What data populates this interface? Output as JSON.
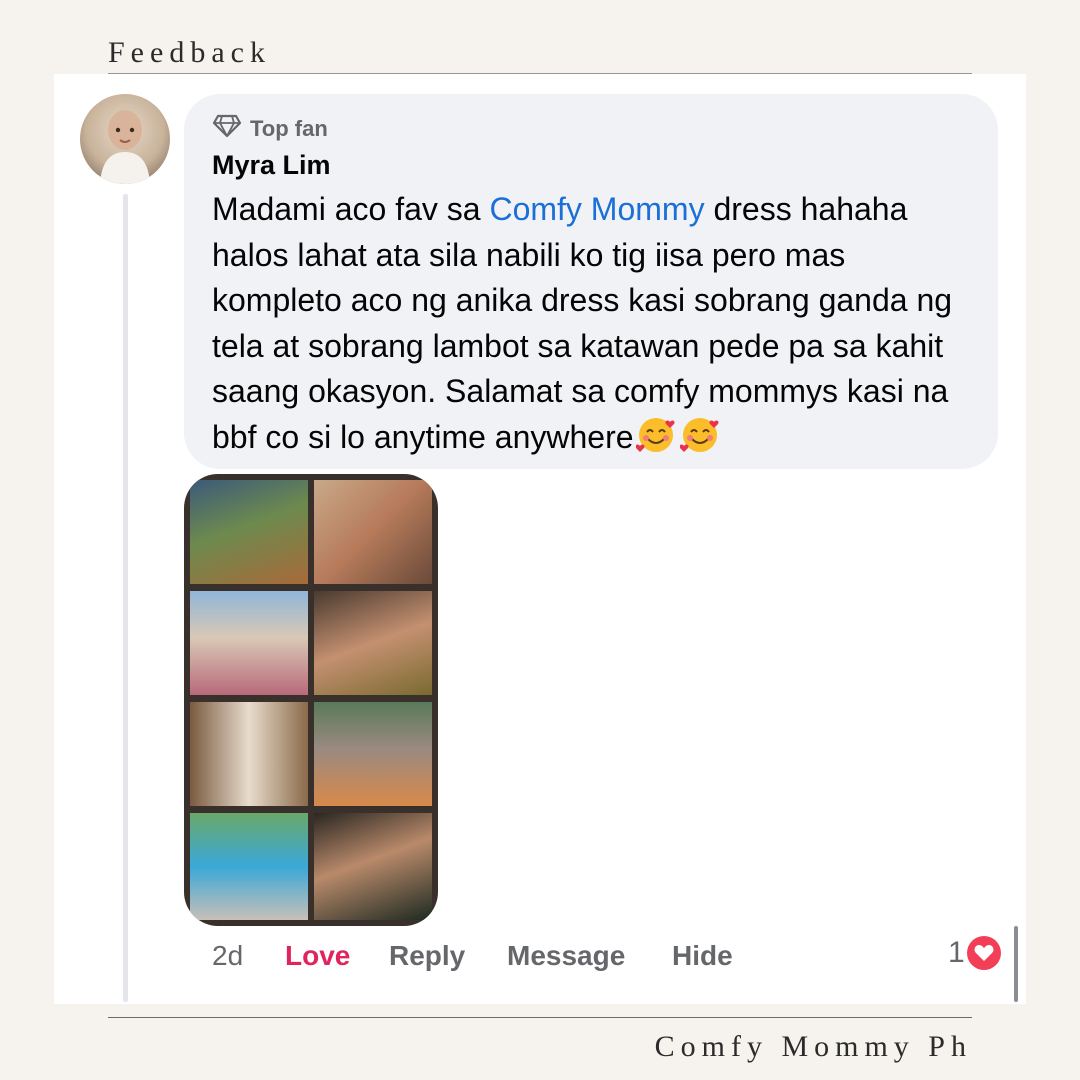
{
  "header": {
    "title": "Feedback"
  },
  "footer": {
    "brand": "Comfy Mommy Ph"
  },
  "comment": {
    "badge": "Top fan",
    "author": "Myra Lim",
    "text_before": "Madami aco fav sa ",
    "mention": "Comfy Mommy",
    "text_after": " dress hahaha halos lahat ata sila nabili ko tig iisa pero mas kompleto aco ng anika dress kasi sobrang ganda ng tela at sobrang lambot sa katawan pede pa sa kahit saang okasyon. Salamat sa comfy mommys kasi na bbf co si lo anytime anywhere",
    "emojis": [
      "smiling-face-with-hearts",
      "smiling-face-with-hearts"
    ],
    "photos": [
      "theme-park-photo",
      "mother-holding-baby-photo",
      "poolside-lounge-photo",
      "mother-baby-selfie-photo",
      "doorway-dress-photo",
      "family-outing-photo",
      "water-park-photo",
      "birthday-cake-photo"
    ]
  },
  "actions": {
    "time": "2d",
    "love": "Love",
    "reply": "Reply",
    "message": "Message",
    "hide": "Hide"
  },
  "reactions": {
    "count": "1",
    "type": "love-icon"
  },
  "colors": {
    "mention": "#1b6fd6",
    "love": "#e0245e",
    "heart": "#f33e58",
    "bubble": "#f0f2f5"
  }
}
